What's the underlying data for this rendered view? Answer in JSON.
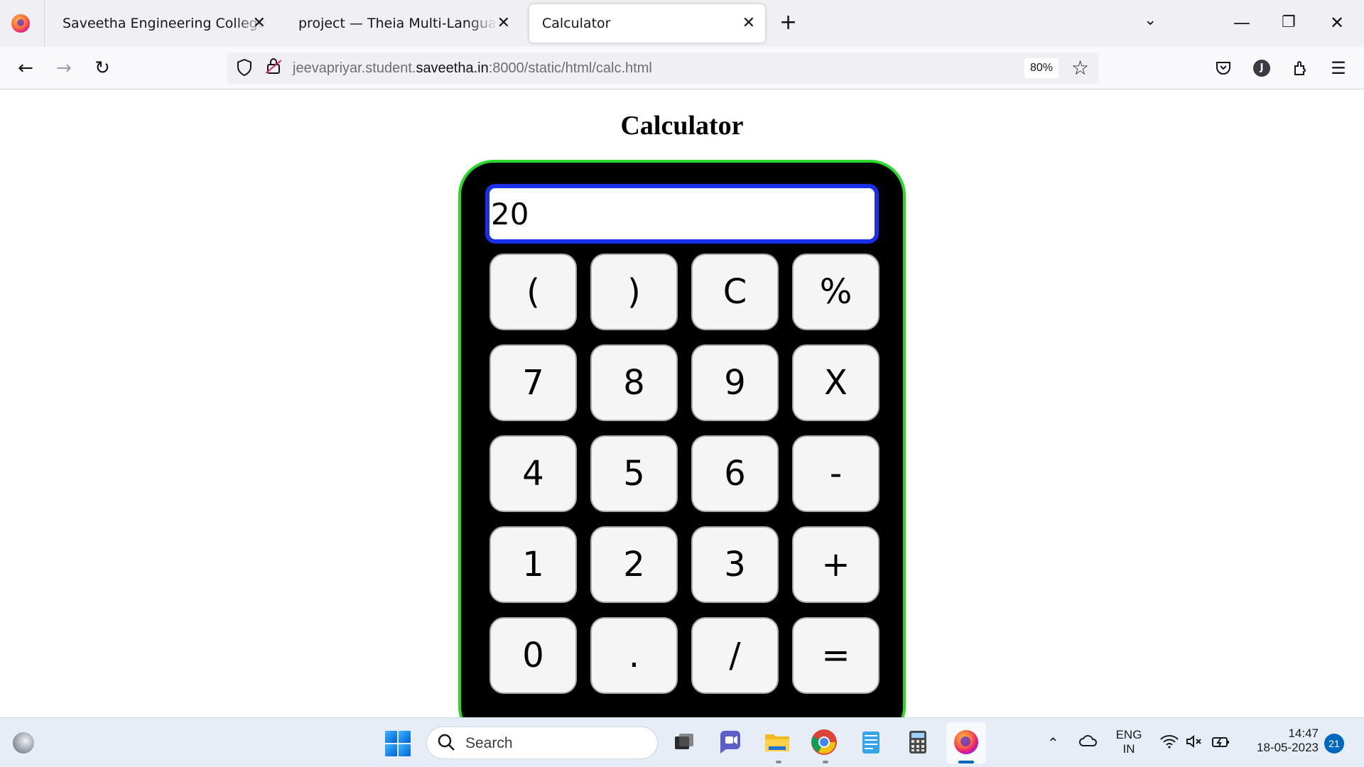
{
  "browser": {
    "tabs": [
      {
        "label": "Saveetha Engineering College",
        "close": "✕"
      },
      {
        "label": "project — Theia Multi-Language Explorer",
        "close": "✕"
      },
      {
        "label": "Calculator",
        "close": "✕"
      }
    ],
    "new_tab": "+",
    "tab_list": "⌄",
    "window_controls": {
      "minimize": "—",
      "restore": "❐",
      "close": "✕"
    },
    "nav": {
      "back": "←",
      "forward": "→",
      "reload": "↻"
    },
    "url": {
      "prefix": "jeevapriyar.student.",
      "domain": "saveetha.in",
      "suffix": ":8000/static/html/calc.html"
    },
    "zoom": "80%",
    "bookmark_star": "☆",
    "toolbar": {
      "pocket": "⛉",
      "account_initial": "J",
      "extensions": "⧉",
      "menu": "☰"
    }
  },
  "page": {
    "title": "Calculator",
    "display_value": "20",
    "keys": [
      [
        "(",
        ")",
        "C",
        "%"
      ],
      [
        "7",
        "8",
        "9",
        "X"
      ],
      [
        "4",
        "5",
        "6",
        "-"
      ],
      [
        "1",
        "2",
        "3",
        "+"
      ],
      [
        "0",
        ".",
        "/",
        "="
      ]
    ],
    "colors": {
      "frame_border": "#2bd92b",
      "frame_bg": "#000000",
      "display_border": "#1a30e8",
      "key_bg": "#f5f5f5"
    }
  },
  "taskbar": {
    "search_label": "Search",
    "search_icon": "search-icon",
    "tray": {
      "chevron": "⌃",
      "language_line1": "ENG",
      "language_line2": "IN",
      "time": "14:47",
      "date": "18-05-2023",
      "notifications": "21"
    }
  }
}
